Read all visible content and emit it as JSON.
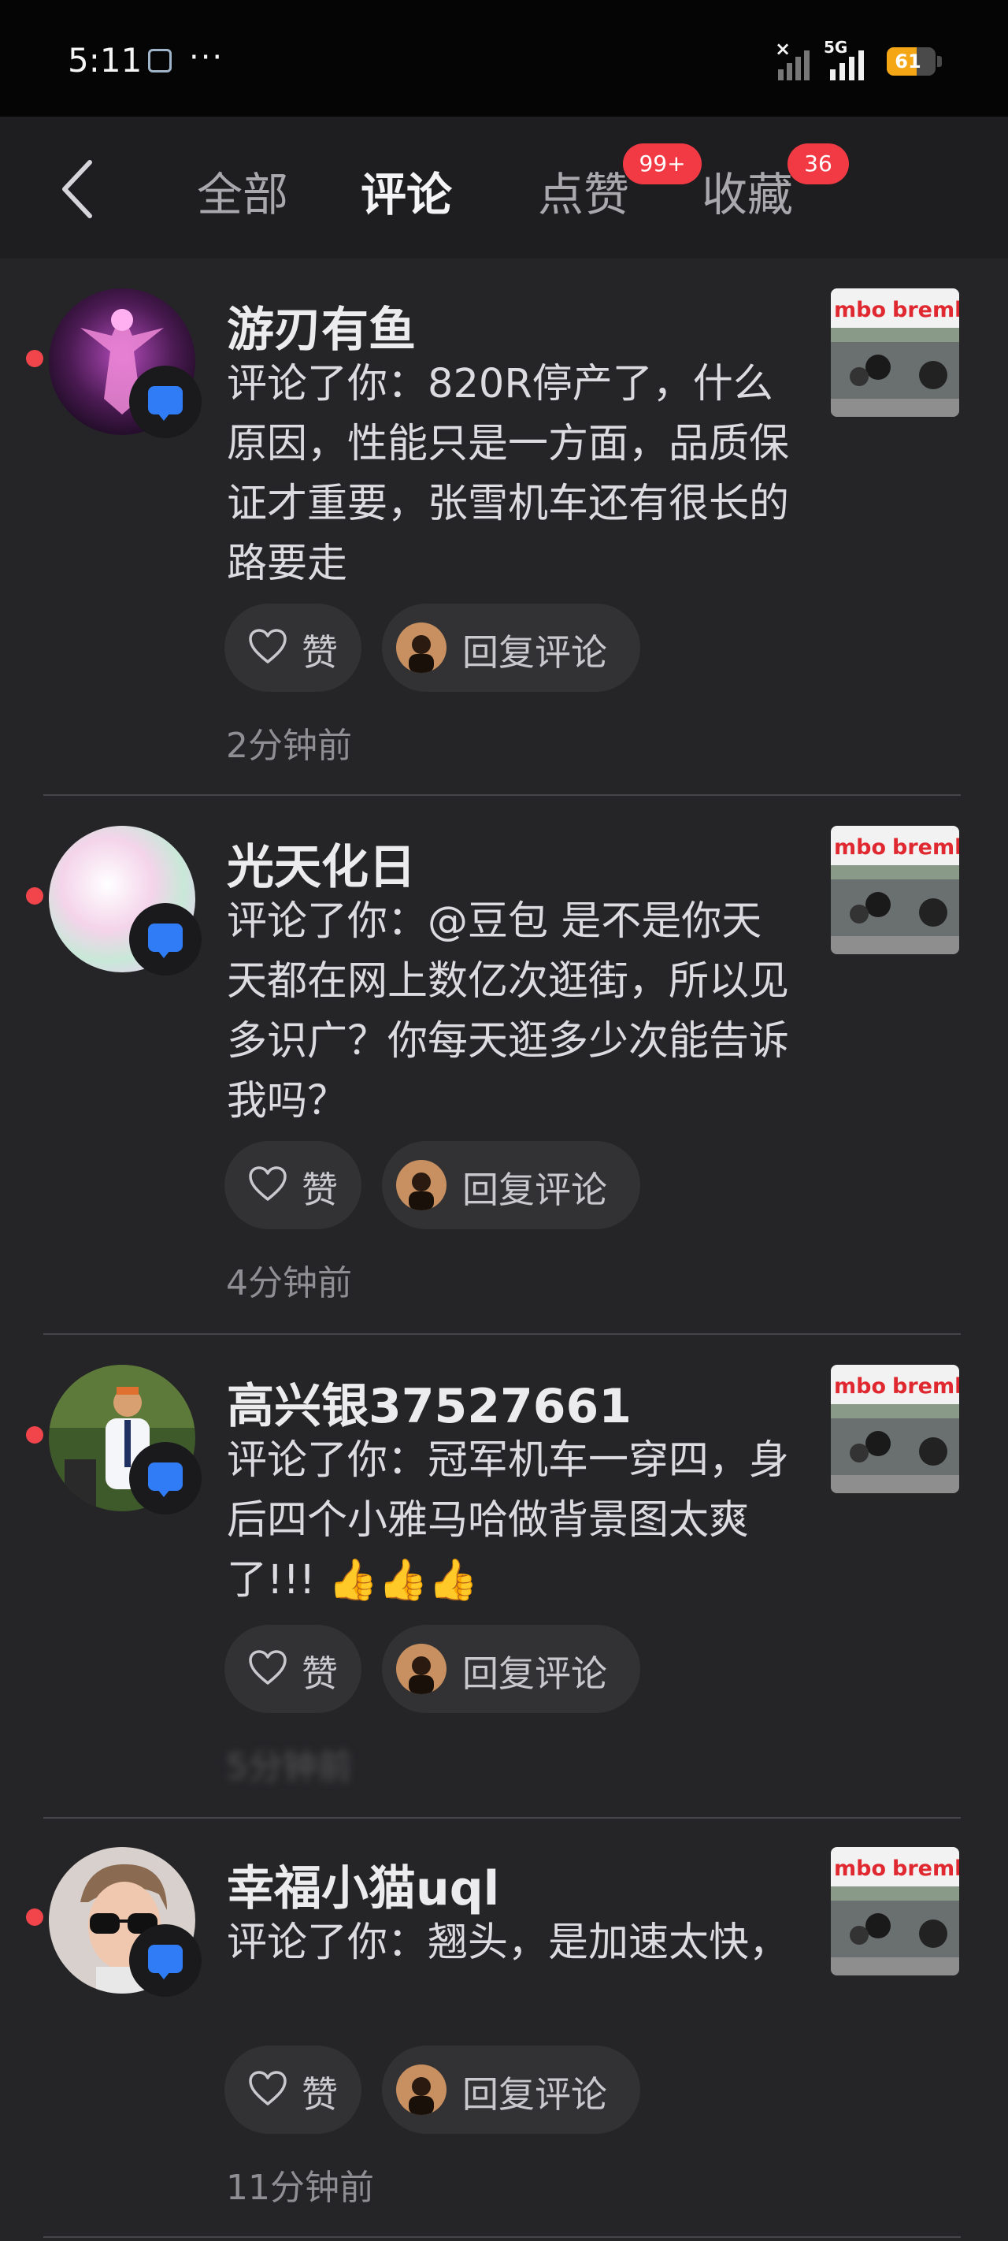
{
  "status_bar": {
    "time": "5:11",
    "battery": "61",
    "network": "5G"
  },
  "header": {
    "tabs": [
      {
        "label": "全部"
      },
      {
        "label": "评论"
      },
      {
        "label": "点赞",
        "badge": "99+"
      },
      {
        "label": "收藏",
        "badge": "36"
      }
    ]
  },
  "notifications": [
    {
      "name": "游刃有鱼",
      "comment": "评论了你：820R停产了，什么原因，性能只是一方面，品质保证才重要，张雪机车还有很长的路要走",
      "like_label": "赞",
      "reply_label": "回复评论",
      "time": "2分钟前"
    },
    {
      "name": "光天化日",
      "comment": "评论了你：@豆包 是不是你天天都在网上数亿次逛街，所以见多识广？你每天逛多少次能告诉我吗？",
      "like_label": "赞",
      "reply_label": "回复评论",
      "time": "4分钟前"
    },
    {
      "name": "高兴银37527661",
      "comment": "评论了你：冠军机车一穿四，身后四个小雅马哈做背景图太爽了!!! 👍👍👍",
      "like_label": "赞",
      "reply_label": "回复评论",
      "time": "5分钟前"
    },
    {
      "name": "幸福小猫uql",
      "comment": "评论了你：翘头，是加速太快，",
      "like_label": "赞",
      "reply_label": "回复评论",
      "time": "11分钟前"
    }
  ],
  "colors": {
    "background": "#252528",
    "unread_dot": "#f2454b",
    "badge": "#f23a45",
    "comment_badge": "#2f7cf6"
  }
}
